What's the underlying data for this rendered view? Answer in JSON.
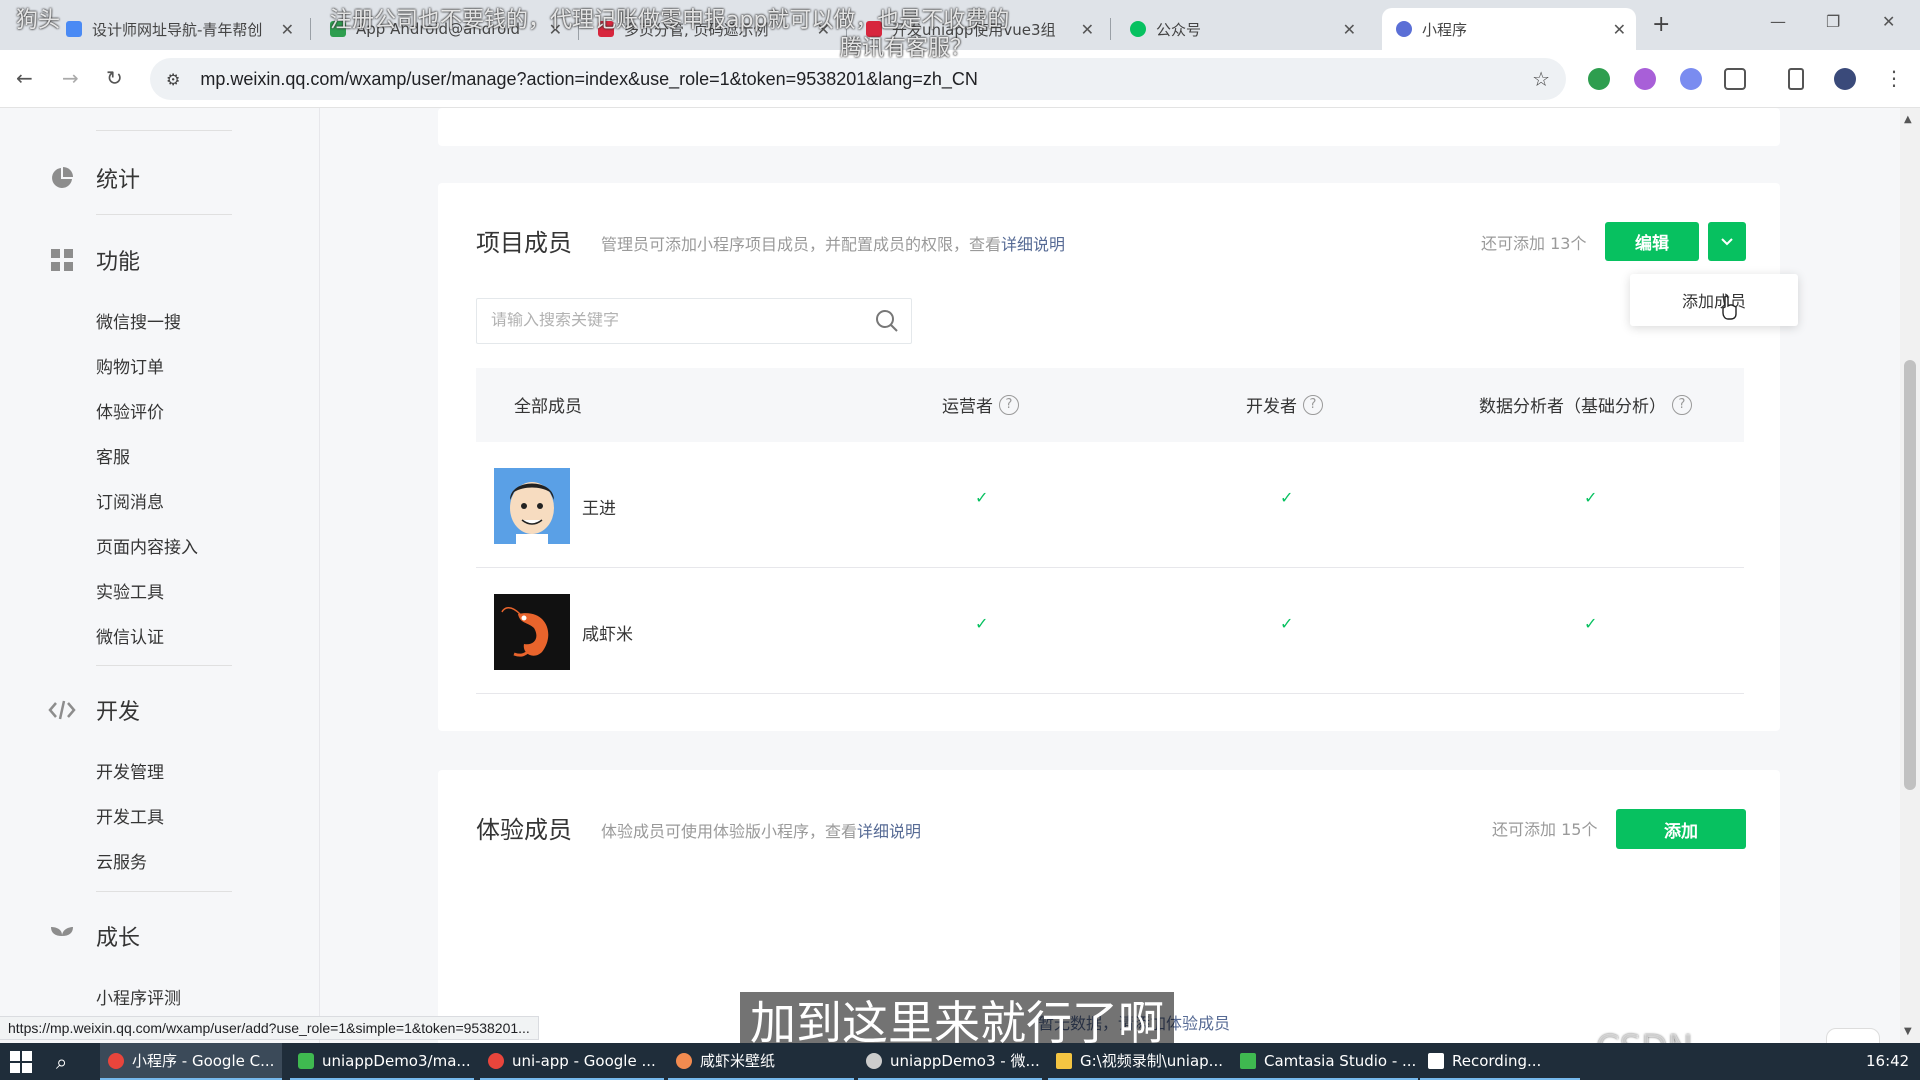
{
  "browser": {
    "tabs": [
      {
        "title": "设计师网址导航-青年帮创",
        "active": false
      },
      {
        "title": "App Android@android",
        "active": false
      },
      {
        "title": "多页分管, 页码遮示例",
        "active": false
      },
      {
        "title": "开发uniapp使用vue3组",
        "active": false
      },
      {
        "title": "公众号",
        "active": false
      },
      {
        "title": "小程序",
        "active": true
      }
    ],
    "url": "mp.weixin.qq.com/wxamp/user/manage?action=index&use_role=1&token=9538201&lang=zh_CN",
    "status_url": "https://mp.weixin.qq.com/wxamp/user/add?use_role=1&simple=1&token=9538201..."
  },
  "sidebar": {
    "groups": [
      {
        "label": "统计",
        "icon": "pie-chart-icon"
      },
      {
        "label": "功能",
        "icon": "grid-icon"
      },
      {
        "label": "开发",
        "icon": "code-icon"
      },
      {
        "label": "成长",
        "icon": "sprout-icon"
      }
    ],
    "function_items": [
      "微信搜一搜",
      "购物订单",
      "体验评价",
      "客服",
      "订阅消息",
      "页面内容接入",
      "实验工具",
      "微信认证"
    ],
    "dev_items": [
      "开发管理",
      "开发工具",
      "云服务"
    ],
    "growth_items": [
      "小程序评测"
    ]
  },
  "project_members": {
    "title": "项目成员",
    "desc": "管理员可添加小程序项目成员，并配置成员的权限，查看",
    "desc_link": "详细说明",
    "quota": "还可添加 13个",
    "edit_label": "编辑",
    "dropdown_item": "添加成员",
    "search_placeholder": "请输入搜索关键字",
    "columns": [
      "全部成员",
      "运营者",
      "开发者",
      "数据分析者（基础分析）"
    ],
    "members": [
      {
        "name": "王进",
        "operator": "✓",
        "developer": "✓",
        "analyst": "✓"
      },
      {
        "name": "咸虾米",
        "operator": "✓",
        "developer": "✓",
        "analyst": "✓"
      }
    ]
  },
  "trial_members": {
    "title": "体验成员",
    "desc": "体验成员可使用体验版小程序，查看",
    "desc_link": "详细说明",
    "quota": "还可添加 15个",
    "add_label": "添加",
    "empty_text": "暂无数据，请添加体验成员"
  },
  "overlay": {
    "subtitle": "加到这里来就行了啊",
    "danmaku_1": "注册公司也不要钱的，代理记账做零申报app就可以做，也是不收费的",
    "danmaku_2": "腾讯有客服？",
    "danmaku_3": "狗头",
    "watermark": "CSDN @wang_book"
  },
  "taskbar": {
    "items": [
      {
        "label": "小程序 - Google C...",
        "color": "#e8453c",
        "active": true
      },
      {
        "label": "uniappDemo3/ma...",
        "color": "#3fb950",
        "active": false
      },
      {
        "label": "uni-app - Google ...",
        "color": "#e8453c",
        "active": false
      },
      {
        "label": "咸虾米壁纸",
        "color": "#f28b50",
        "active": false
      },
      {
        "label": "uniappDemo3 - 微...",
        "color": "#cccccc",
        "active": false
      },
      {
        "label": "G:\\视频录制\\uniap...",
        "color": "#f4c542",
        "active": false
      },
      {
        "label": "Camtasia Studio - ...",
        "color": "#3fb950",
        "active": false
      },
      {
        "label": "Recording...",
        "color": "#ffffff",
        "active": false
      }
    ],
    "time": "16:42"
  }
}
